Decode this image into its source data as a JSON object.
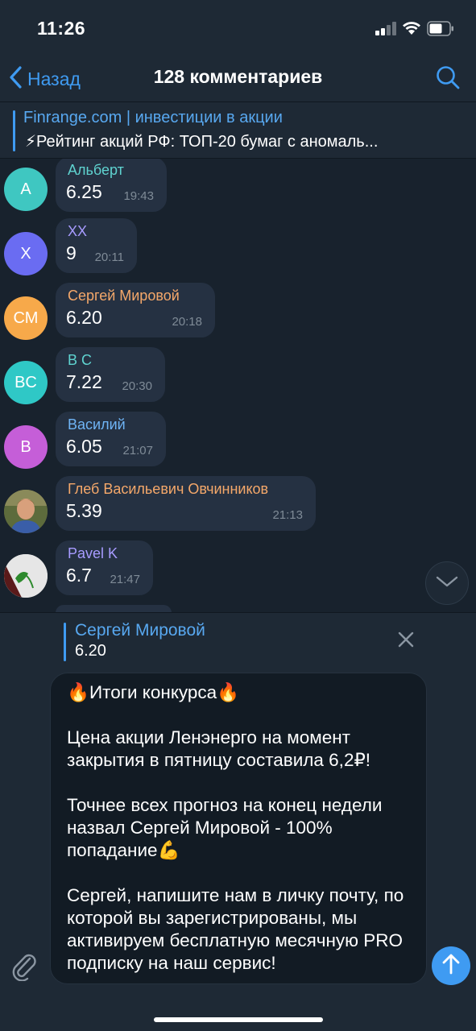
{
  "status_bar": {
    "time": "11:26"
  },
  "nav": {
    "back_label": "Назад",
    "title": "128 комментариев"
  },
  "pinned": {
    "channel": "Finrange.com | инвестиции в акции",
    "text": "⚡Рейтинг акций РФ: ТОП-20 бумаг с аномаль..."
  },
  "comments": [
    {
      "initials": "А",
      "author": "Альберт",
      "text": "6.25",
      "time": "19:43",
      "avatar_color": "#3fc7c1",
      "author_color": "#5fd3d0"
    },
    {
      "initials": "X",
      "author": "XX",
      "text": "9",
      "time": "20:11",
      "avatar_color": "#6a6cf2",
      "author_color": "#a79bff"
    },
    {
      "initials": "СМ",
      "author": "Сергей Мировой",
      "text": "6.20",
      "time": "20:18",
      "avatar_color": "#f7a94a",
      "author_color": "#f5a86a"
    },
    {
      "initials": "BC",
      "author": "B C",
      "text": "7.22",
      "time": "20:30",
      "avatar_color": "#2fc8c6",
      "author_color": "#5fd3d0"
    },
    {
      "initials": "В",
      "author": "Василий",
      "text": "6.05",
      "time": "21:07",
      "avatar_color": "#c55ed8",
      "author_color": "#6fb4f5"
    },
    {
      "initials": "",
      "author": "Глеб Васильевич Овчинников",
      "text": "5.39",
      "time": "21:13",
      "avatar_color": "#6b5a3a",
      "author_color": "#f5a86a"
    },
    {
      "initials": "",
      "author": "Pavel K",
      "text": "6.7",
      "time": "21:47",
      "avatar_color": "#d9d9d9",
      "author_color": "#a79bff"
    }
  ],
  "reply": {
    "author": "Сергей Мировой",
    "text": "6.20"
  },
  "composer": {
    "paragraphs": [
      "🔥Итоги конкурса🔥",
      "Цена акции Ленэнерго на момент закрытия в пятницу составила 6,2₽!",
      "Точнее всех прогноз на конец недели назвал Сергей Мировой - 100% попадание💪",
      "Сергей, напишите нам в личку почту, по которой вы зарегистрированы, мы активируем бесплатную месячную PRO подписку на наш сервис!"
    ]
  },
  "colors": {
    "accent": "#3f9bf2",
    "background": "#18222d",
    "bubble": "#253142",
    "panel": "#1e2935"
  }
}
